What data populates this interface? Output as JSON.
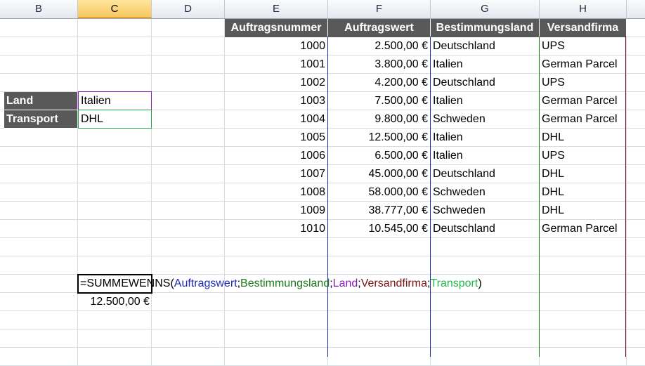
{
  "columns": [
    "B",
    "C",
    "D",
    "E",
    "F",
    "G",
    "H"
  ],
  "selected_column": "C",
  "table": {
    "headers": [
      "Auftragsnummer",
      "Auftragswert",
      "Bestimmungsland",
      "Versandfirma"
    ],
    "rows": [
      [
        "1000",
        "2.500,00 €",
        "Deutschland",
        "UPS"
      ],
      [
        "1001",
        "3.800,00 €",
        "Italien",
        "German Parcel"
      ],
      [
        "1002",
        "4.200,00 €",
        "Deutschland",
        "UPS"
      ],
      [
        "1003",
        "7.500,00 €",
        "Italien",
        "German Parcel"
      ],
      [
        "1004",
        "9.800,00 €",
        "Schweden",
        "German Parcel"
      ],
      [
        "1005",
        "12.500,00 €",
        "Italien",
        "DHL"
      ],
      [
        "1006",
        "6.500,00 €",
        "Italien",
        "UPS"
      ],
      [
        "1007",
        "45.000,00 €",
        "Deutschland",
        "DHL"
      ],
      [
        "1008",
        "58.000,00 €",
        "Schweden",
        "DHL"
      ],
      [
        "1009",
        "38.777,00 €",
        "Schweden",
        "DHL"
      ],
      [
        "1010",
        "10.545,00 €",
        "Deutschland",
        "German Parcel"
      ]
    ]
  },
  "criteria": {
    "land_label": "Land",
    "land_value": "Italien",
    "transport_label": "Transport",
    "transport_value": "DHL"
  },
  "formula": {
    "parts": [
      {
        "text": "=SUMMEWENNS(",
        "color": "#000000"
      },
      {
        "text": "Auftragswert",
        "color": "#1f2bb0"
      },
      {
        "text": ";",
        "color": "#000000"
      },
      {
        "text": "Bestimmungsland",
        "color": "#1a7a1a"
      },
      {
        "text": ";",
        "color": "#000000"
      },
      {
        "text": "Land",
        "color": "#8a1cb8"
      },
      {
        "text": ";",
        "color": "#000000"
      },
      {
        "text": "Versandfirma",
        "color": "#7a1414"
      },
      {
        "text": ";",
        "color": "#000000"
      },
      {
        "text": "Transport",
        "color": "#22b84a"
      },
      {
        "text": ")",
        "color": "#000000"
      }
    ],
    "result": "12.500,00 €"
  },
  "colors": {
    "header_fill": "#595959",
    "range_auftragswert": "#1f2bb0",
    "range_bestimmungsland": "#1a7a1a",
    "range_versandfirma": "#7a1414"
  }
}
